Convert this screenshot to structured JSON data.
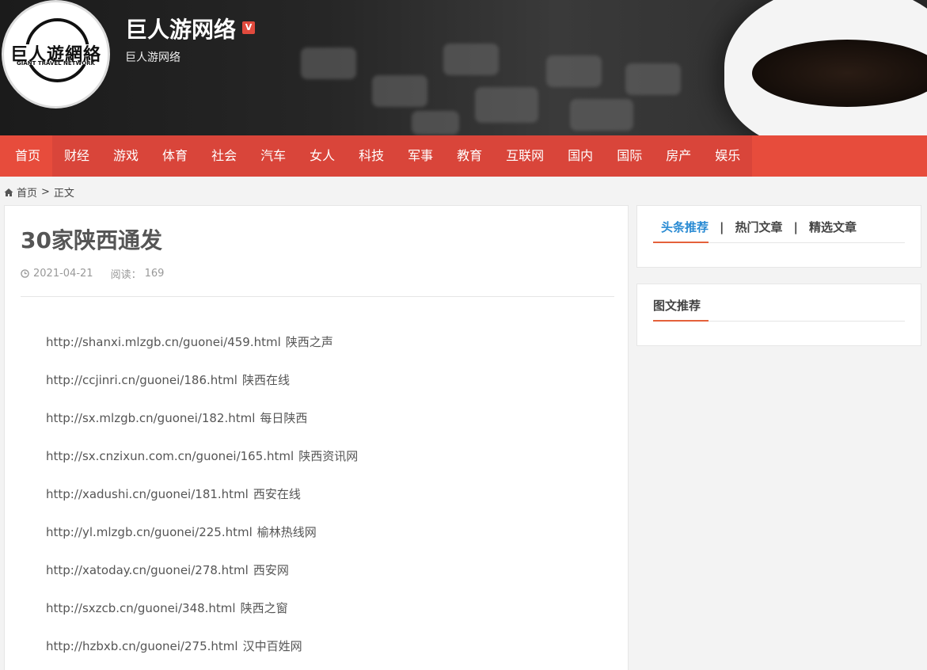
{
  "site": {
    "title": "巨人游网络",
    "subtitle": "巨人游网络",
    "badge": "V",
    "logo_cn": "巨人遊網絡",
    "logo_en": "GIANT TRAVEL NETWORK"
  },
  "nav": {
    "items": [
      "首页",
      "财经",
      "游戏",
      "体育",
      "社会",
      "汽车",
      "女人",
      "科技",
      "军事",
      "教育",
      "互联网",
      "国内",
      "国际",
      "房产",
      "娱乐"
    ],
    "active_index": 0
  },
  "breadcrumb": {
    "home": "首页",
    "separator": ">",
    "current": "正文"
  },
  "article": {
    "title": "30家陕西通发",
    "date": "2021-04-21",
    "views_label": "阅读：",
    "views": "169",
    "links": [
      {
        "url": "http://shanxi.mlzgb.cn/guonei/459.html",
        "name": "陕西之声"
      },
      {
        "url": "http://ccjinri.cn/guonei/186.html",
        "name": "陕西在线"
      },
      {
        "url": "http://sx.mlzgb.cn/guonei/182.html",
        "name": "每日陕西"
      },
      {
        "url": "http://sx.cnzixun.com.cn/guonei/165.html",
        "name": "陕西资讯网"
      },
      {
        "url": "http://xadushi.cn/guonei/181.html",
        "name": "西安在线"
      },
      {
        "url": "http://yl.mlzgb.cn/guonei/225.html",
        "name": "榆林热线网"
      },
      {
        "url": "http://xatoday.cn/guonei/278.html",
        "name": "西安网"
      },
      {
        "url": "http://sxzcb.cn/guonei/348.html",
        "name": "陕西之窗"
      },
      {
        "url": "http://hzbxb.cn/guonei/275.html",
        "name": "汉中百姓网"
      }
    ]
  },
  "sidebar": {
    "tabs": [
      "头条推荐",
      "热门文章",
      "精选文章"
    ],
    "tab_separator": "|",
    "image_section_title": "图文推荐"
  },
  "colors": {
    "nav_bg": "#e74c3c",
    "tab_active": "#2a8bd3",
    "underline": "#e4613b"
  }
}
